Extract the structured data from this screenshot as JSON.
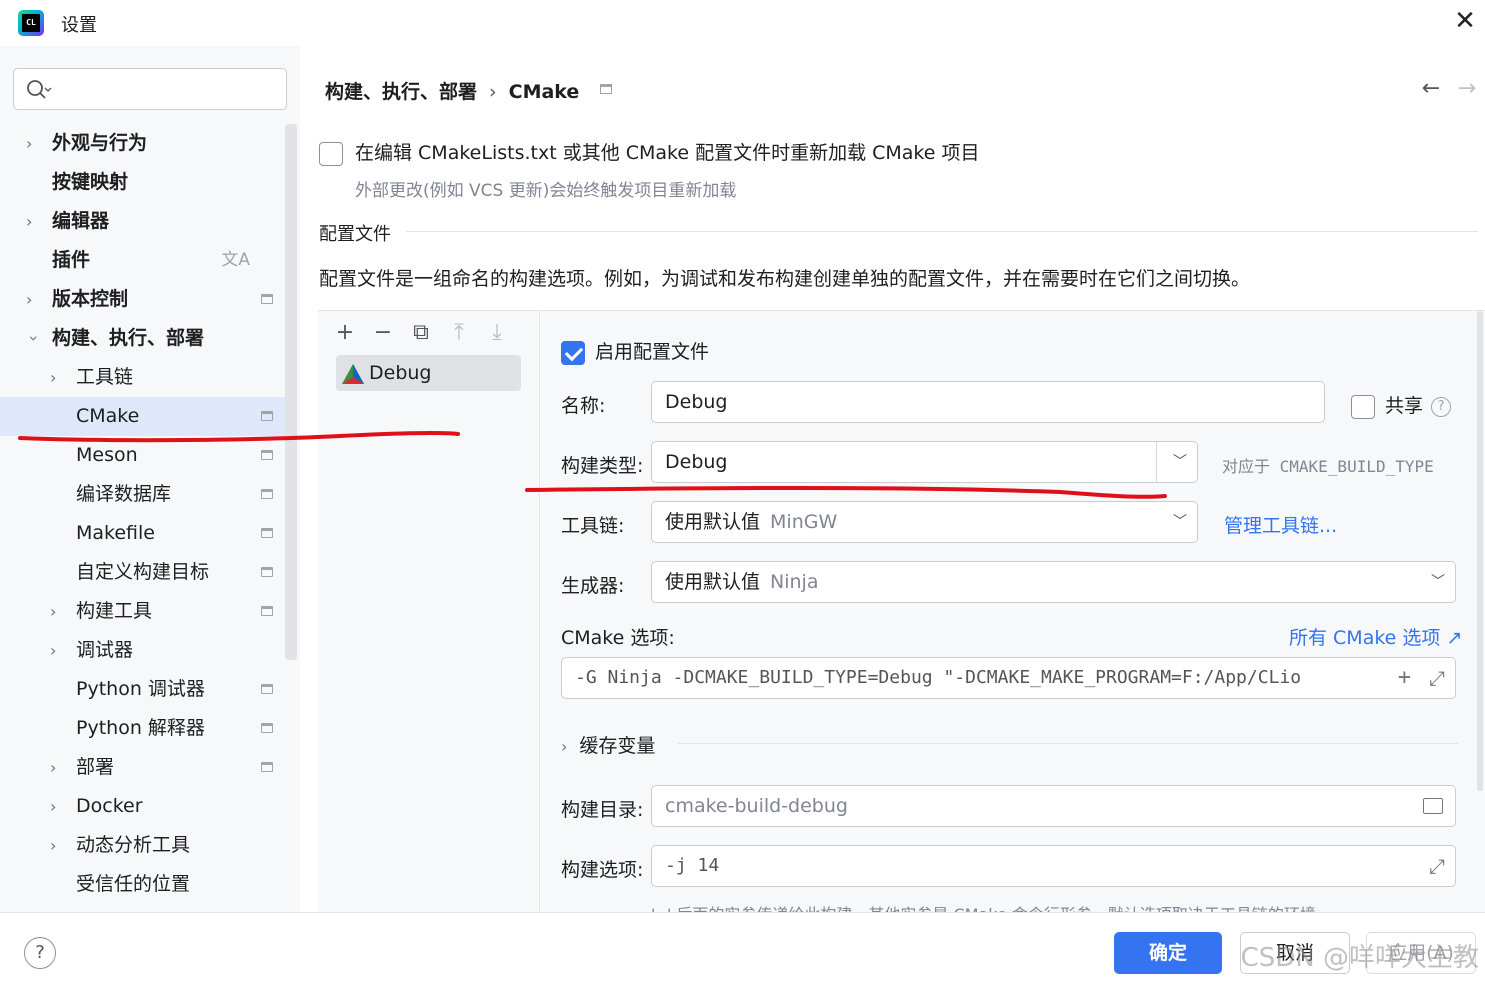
{
  "window": {
    "title": "设置",
    "app_icon_text": "CL"
  },
  "search": {
    "placeholder": ""
  },
  "sidebar": {
    "items": [
      {
        "label": "外观与行为",
        "level": 0,
        "expandable": true,
        "expanded": false,
        "pinnable": false
      },
      {
        "label": "按键映射",
        "level": 0,
        "expandable": false,
        "pinnable": false
      },
      {
        "label": "编辑器",
        "level": 0,
        "expandable": true,
        "expanded": false,
        "pinnable": false
      },
      {
        "label": "插件",
        "level": 0,
        "expandable": false,
        "pinnable": false,
        "translate_icon": true
      },
      {
        "label": "版本控制",
        "level": 0,
        "expandable": true,
        "expanded": false,
        "pinnable": true
      },
      {
        "label": "构建、执行、部署",
        "level": 0,
        "expandable": true,
        "expanded": true,
        "pinnable": false
      },
      {
        "label": "工具链",
        "level": 1,
        "expandable": true,
        "expanded": false,
        "pinnable": false
      },
      {
        "label": "CMake",
        "level": 1,
        "expandable": false,
        "pinnable": true,
        "selected": true
      },
      {
        "label": "Meson",
        "level": 1,
        "expandable": false,
        "pinnable": true
      },
      {
        "label": "编译数据库",
        "level": 1,
        "expandable": false,
        "pinnable": true
      },
      {
        "label": "Makefile",
        "level": 1,
        "expandable": false,
        "pinnable": true
      },
      {
        "label": "自定义构建目标",
        "level": 1,
        "expandable": false,
        "pinnable": true
      },
      {
        "label": "构建工具",
        "level": 1,
        "expandable": true,
        "expanded": false,
        "pinnable": true
      },
      {
        "label": "调试器",
        "level": 1,
        "expandable": true,
        "expanded": false,
        "pinnable": false
      },
      {
        "label": "Python 调试器",
        "level": 1,
        "expandable": false,
        "pinnable": true
      },
      {
        "label": "Python 解释器",
        "level": 1,
        "expandable": false,
        "pinnable": true
      },
      {
        "label": "部署",
        "level": 1,
        "expandable": true,
        "expanded": false,
        "pinnable": true
      },
      {
        "label": "Docker",
        "level": 1,
        "expandable": true,
        "expanded": false,
        "pinnable": false
      },
      {
        "label": "动态分析工具",
        "level": 1,
        "expandable": true,
        "expanded": false,
        "pinnable": false
      },
      {
        "label": "受信任的位置",
        "level": 1,
        "expandable": false,
        "pinnable": false
      }
    ]
  },
  "breadcrumb": {
    "parent": "构建、执行、部署",
    "separator": "›",
    "current": "CMake"
  },
  "reload": {
    "label": "在编辑 CMakeLists.txt 或其他 CMake 配置文件时重新加载 CMake 项目",
    "checked": false,
    "hint": "外部更改(例如 VCS 更新)会始终触发项目重新加载"
  },
  "profiles_section": {
    "title": "配置文件",
    "description": "配置文件是一组命名的构建选项。例如，为调试和发布构建创建单独的配置文件，并在需要时在它们之间切换。",
    "list": [
      {
        "name": "Debug"
      }
    ]
  },
  "form": {
    "enable_label": "启用配置文件",
    "enable_checked": true,
    "name_label": "名称:",
    "name_value": "Debug",
    "share_label": "共享",
    "share_checked": false,
    "build_type_label": "构建类型:",
    "build_type_value": "Debug",
    "build_type_hint": "对应于 CMAKE_BUILD_TYPE",
    "toolchain_label": "工具链:",
    "toolchain_value": "使用默认值",
    "toolchain_muted": "MinGW",
    "manage_toolchains": "管理工具链...",
    "generator_label": "生成器:",
    "generator_value": "使用默认值",
    "generator_muted": "Ninja",
    "cmake_options_label": "CMake 选项:",
    "all_cmake_options": "所有 CMake 选项 ↗",
    "cmake_options_value": "-G Ninja -DCMAKE_BUILD_TYPE=Debug \"-DCMAKE_MAKE_PROGRAM=F:/App/CLio",
    "cache_vars_label": "缓存变量",
    "build_dir_label": "构建目录:",
    "build_dir_value": "cmake-build-debug",
    "build_options_label": "构建选项:",
    "build_options_value": "-j 14",
    "bottom_hint": "'--' 后面的实参传递给此构建，其他实参是 CMake 命令行形参。默认选项取决于工具链的环境"
  },
  "footer": {
    "ok": "确定",
    "cancel": "取消",
    "apply": "应用(A)",
    "watermark": "CSDN @咩咩大主教"
  },
  "colors": {
    "accent": "#3574f0",
    "selected_bg": "#dfe8fb",
    "annotation": "#e0101a"
  }
}
